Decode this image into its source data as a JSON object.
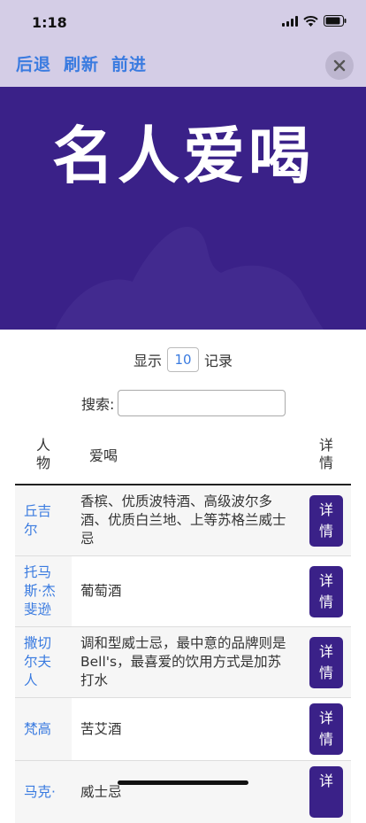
{
  "status": {
    "time": "1:18"
  },
  "toolbar": {
    "back": "后退",
    "refresh": "刷新",
    "forward": "前进"
  },
  "hero": {
    "title": "名人爱喝"
  },
  "table_controls": {
    "show_label": "显示",
    "length_value": "10",
    "records_label": "记录",
    "search_label": "搜索:",
    "search_value": ""
  },
  "table": {
    "headers": {
      "person": "人物",
      "drink": "爱喝",
      "detail": "详情"
    },
    "rows": [
      {
        "person": "丘吉尔",
        "drink": "香槟、优质波特酒、高级波尔多酒、优质白兰地、上等苏格兰威士忌",
        "detail": "详情"
      },
      {
        "person": "托马斯·杰斐逊",
        "drink": "葡萄酒",
        "detail": "详情"
      },
      {
        "person": "撒切尔夫人",
        "drink": "调和型威士忌，最中意的品牌则是Bell's，最喜爱的饮用方式是加苏打水",
        "detail": "详情"
      },
      {
        "person": "梵高",
        "drink": "苦艾酒",
        "detail": "详情"
      },
      {
        "person": "马克·",
        "drink": "威士忌",
        "detail": "详"
      }
    ]
  }
}
